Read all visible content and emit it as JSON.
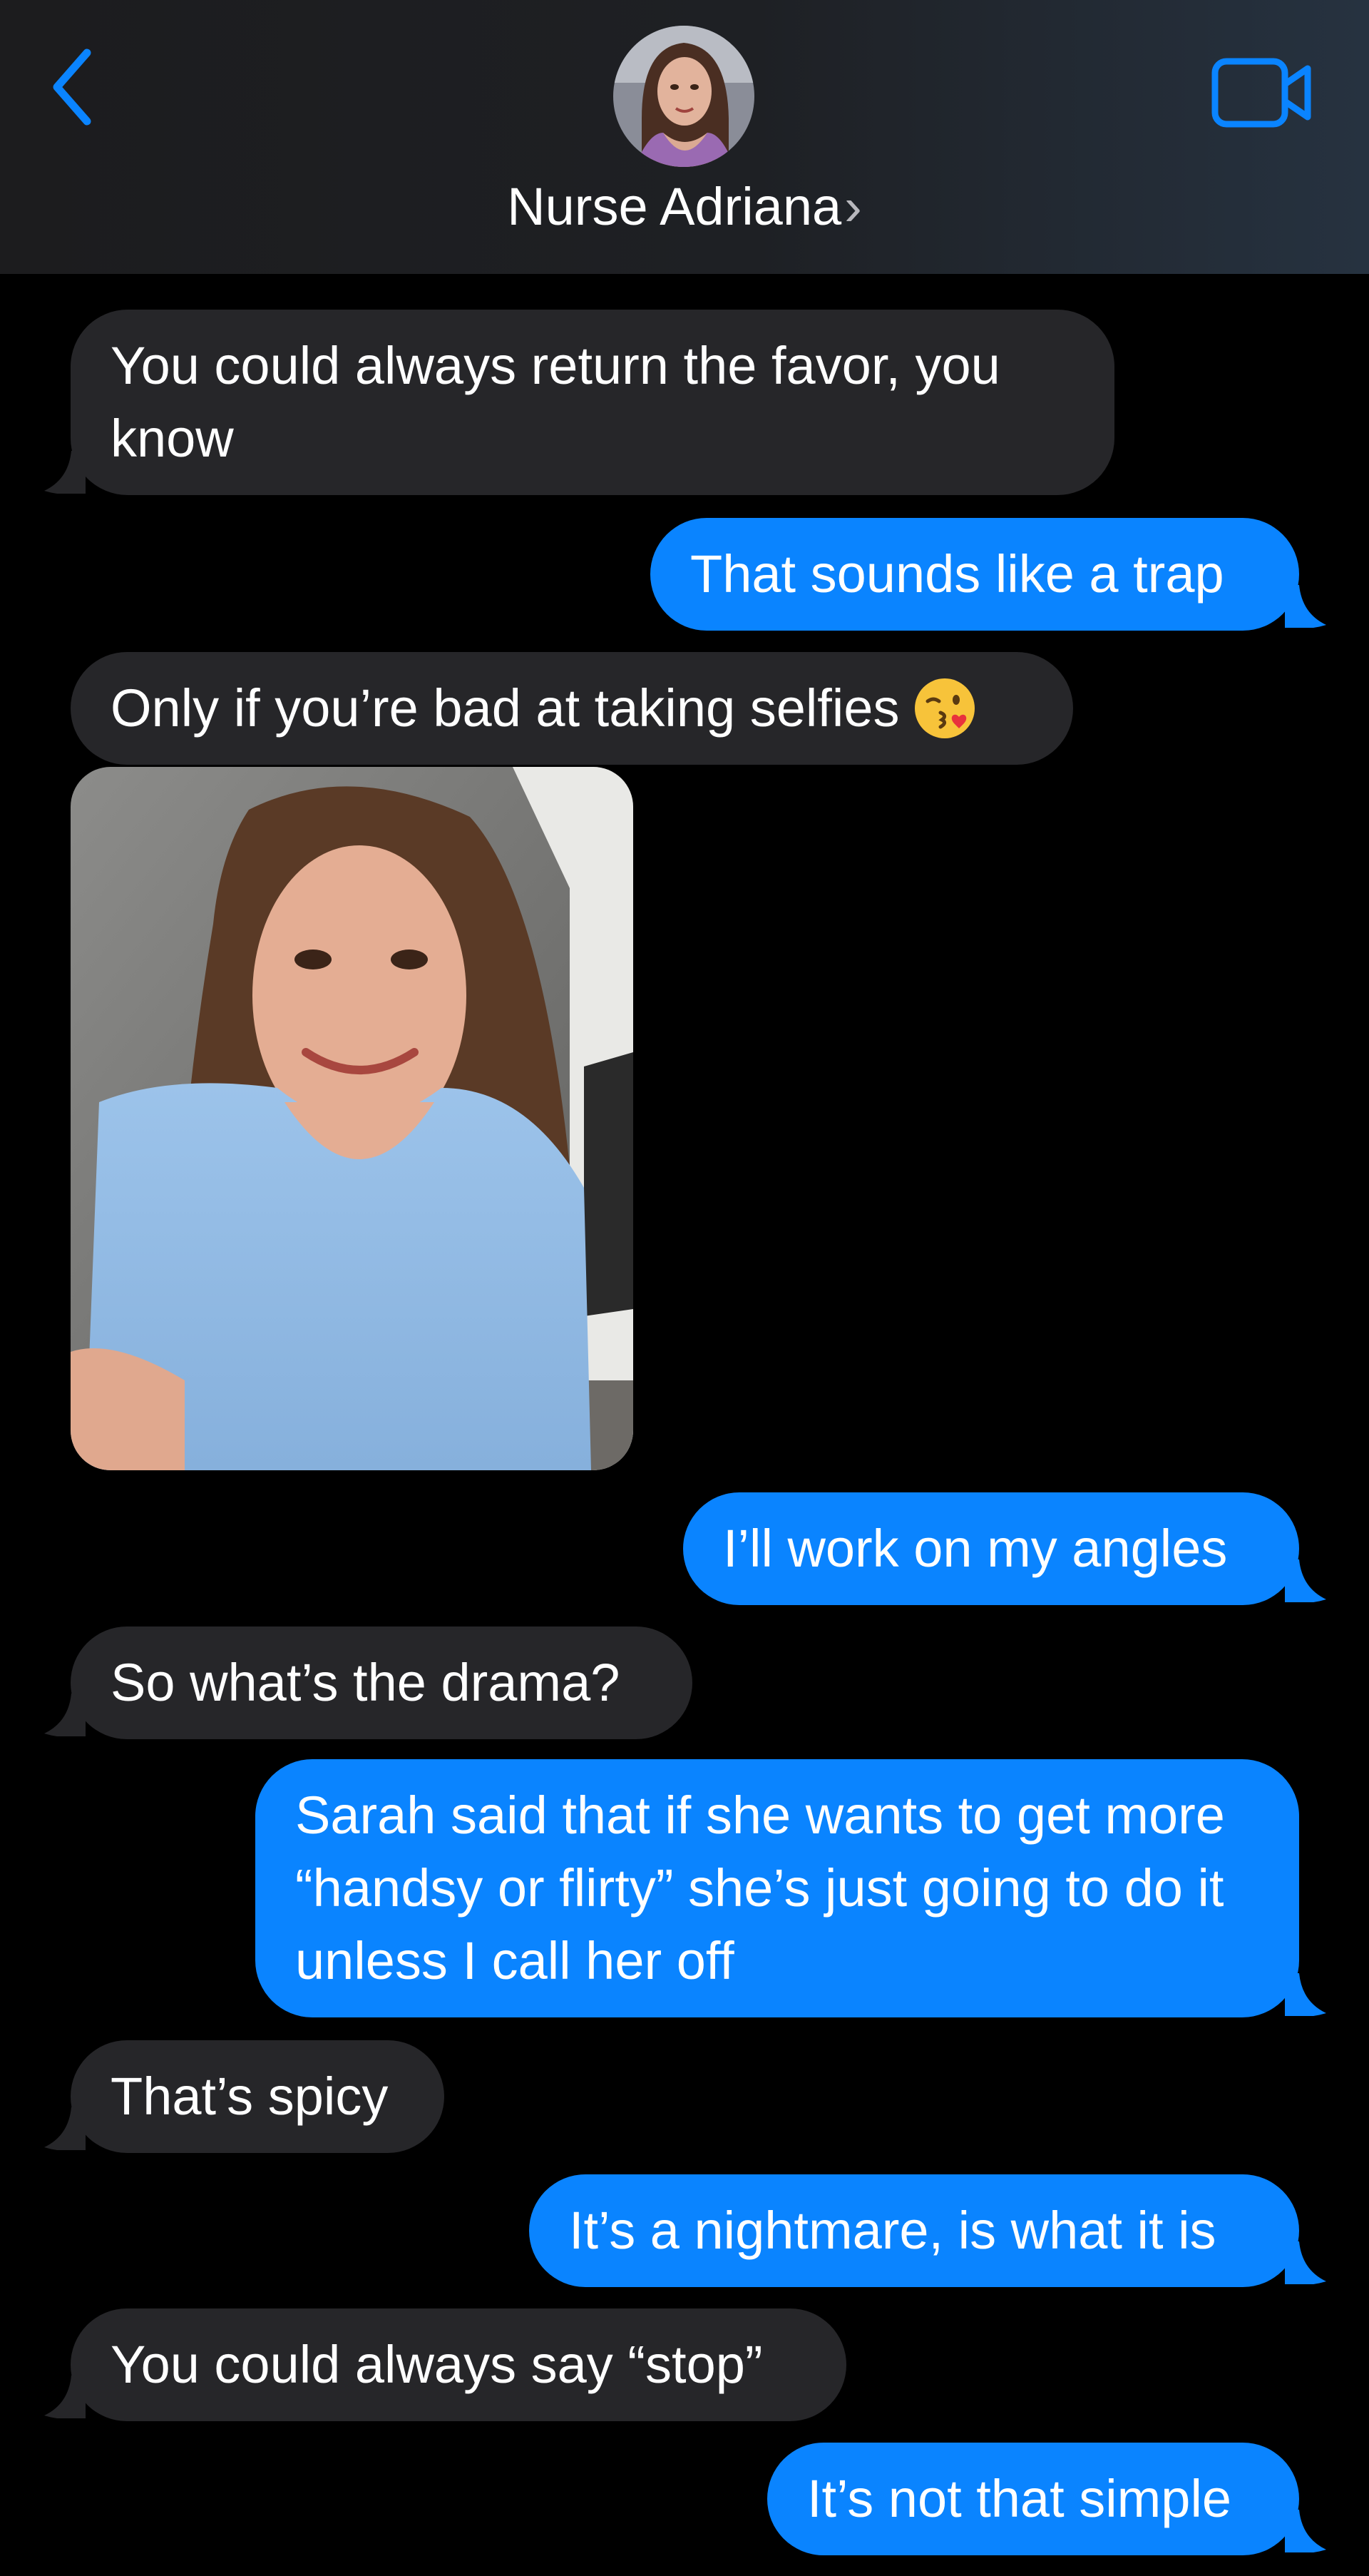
{
  "header": {
    "contact_name": "Nurse Adriana",
    "chevron": "›",
    "back_icon": "chevron-left-icon",
    "video_icon": "video-camera-icon",
    "accent_color": "#0a84ff"
  },
  "messages": [
    {
      "direction": "received",
      "text": "You could always return the favor, you know"
    },
    {
      "direction": "sent",
      "text": "That sounds like a trap"
    },
    {
      "direction": "received",
      "text": "Only if you’re bad at taking selfies",
      "emoji": "face-blowing-a-kiss"
    },
    {
      "direction": "received",
      "type": "image",
      "image": "selfie-photo"
    },
    {
      "direction": "sent",
      "text": "I’ll work on my angles"
    },
    {
      "direction": "received",
      "text": "So what’s the drama?"
    },
    {
      "direction": "sent",
      "text": "Sarah said that if she wants to get more “handsy or flirty” she’s just going to do it unless I call her off"
    },
    {
      "direction": "received",
      "text": "That’s spicy"
    },
    {
      "direction": "sent",
      "text": "It’s a nightmare, is what it is"
    },
    {
      "direction": "received",
      "text": "You could always say “stop”"
    },
    {
      "direction": "sent",
      "text": "It’s not that simple"
    }
  ],
  "colors": {
    "received_bubble": "#262629",
    "sent_bubble": "#0a84ff",
    "background": "#000000"
  }
}
